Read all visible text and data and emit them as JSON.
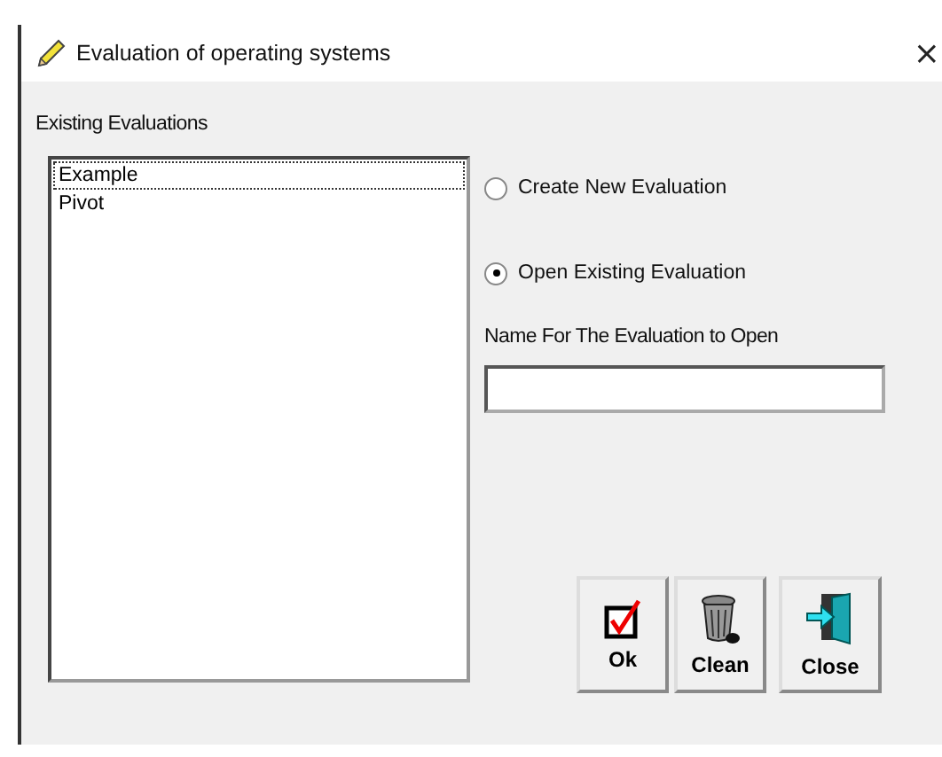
{
  "window": {
    "title": "Evaluation of operating systems",
    "close": "×"
  },
  "existing_label": "Existing Evaluations",
  "evaluations": [
    {
      "name": "Example",
      "selected": true
    },
    {
      "name": "Pivot",
      "selected": false
    }
  ],
  "modes": [
    {
      "label": "Create New Evaluation",
      "selected": false
    },
    {
      "label": "Open Existing Evaluation",
      "selected": true
    }
  ],
  "name_field": {
    "label": "Name For The Evaluation to Open"
  },
  "buttons": [
    {
      "label": "Ok",
      "kind": "ok"
    },
    {
      "label": "Clean",
      "kind": "clean"
    },
    {
      "label": "Close",
      "kind": "close"
    }
  ]
}
